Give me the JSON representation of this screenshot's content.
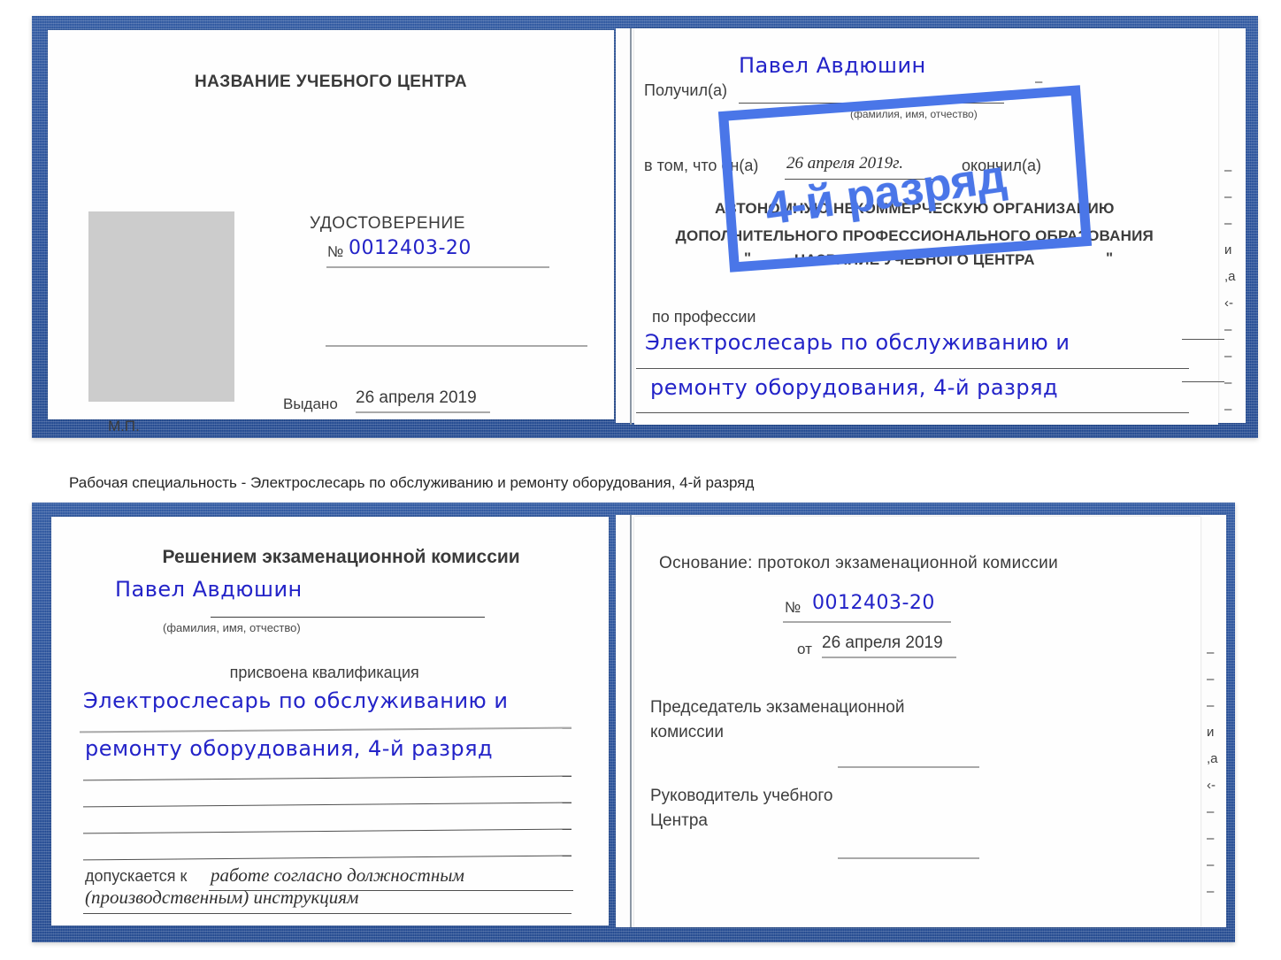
{
  "caption": {
    "text": "Рабочая специальность - Электрослесарь по обслуживанию и ремонту оборудования, 4-й разряд"
  },
  "colors": {
    "cover_blue": "#28509a",
    "handwriting_blue": "#2323c8",
    "stamp_blue": "#4a76e8",
    "page_white": "#fefefe",
    "photo_gray": "#cccccc",
    "rule_gray": "#a9a9a9"
  },
  "certificate_top": {
    "left_page": {
      "heading": "НАЗВАНИЕ УЧЕБНОГО ЦЕНТРА",
      "doc_type": "УДОСТОВЕРЕНИЕ",
      "number_label": "№",
      "number_value": "0012403-20",
      "issued_label": "Выдано",
      "issued_value": "26 апреля 2019",
      "seal_label": "М.П.",
      "photo_placeholder": "photo-placeholder"
    },
    "right_page": {
      "received_label": "Получил(а)",
      "received_value": "Павел Авдюшин",
      "fio_hint": "(фамилия, имя, отчество)",
      "in_that_label": "в том, что он(а)",
      "completion_date": "26 апреля 2019г.",
      "finished_label": "окончил(а)",
      "org_line1": "АВТОНОМНУЮ НЕКОММЕРЧЕСКУЮ ОРГАНИЗАЦИЮ",
      "org_line2": "ДОПОЛНИТЕЛЬНОГО ПРОФЕССИОНАЛЬНОГО ОБРАЗОВАНИЯ",
      "org_quote_open": "\"",
      "org_name": "НАЗВАНИЕ УЧЕБНОГО ЦЕНТРА",
      "org_quote_close": "\"",
      "profession_label": "по профессии",
      "profession_line1": "Электрослесарь по обслуживанию и",
      "profession_line2": "ремонту оборудования, 4-й разряд",
      "edge_marks": "–\n–\n–\nи\n,а\n‹-\n–\n–\n–\n–"
    },
    "stamp": {
      "text": "4-й разряд"
    }
  },
  "certificate_bottom": {
    "left_page": {
      "heading": "Решением экзаменационной комиссии",
      "name_value": "Павел Авдюшин",
      "fio_hint": "(фамилия, имя, отчество)",
      "qualification_label": "присвоена квалификация",
      "qualification_line1": "Электрослесарь по обслуживанию и",
      "qualification_line2": "ремонту оборудования, 4-й разряд",
      "admitted_label": "допускается к",
      "admitted_line1": "работе согласно должностным",
      "admitted_line2": "(производственным) инструкциям"
    },
    "right_page": {
      "basis_label": "Основание: протокол экзаменационной комиссии",
      "number_label": "№",
      "number_value": "0012403-20",
      "date_label": "от",
      "date_value": "26 апреля 2019",
      "chairman_line1": "Председатель экзаменационной",
      "chairman_line2": "комиссии",
      "head_line1": "Руководитель учебного",
      "head_line2": "Центра",
      "edge_marks": "–\n–\n–\nи\n,а\n‹-\n–\n–\n–\n–"
    }
  }
}
